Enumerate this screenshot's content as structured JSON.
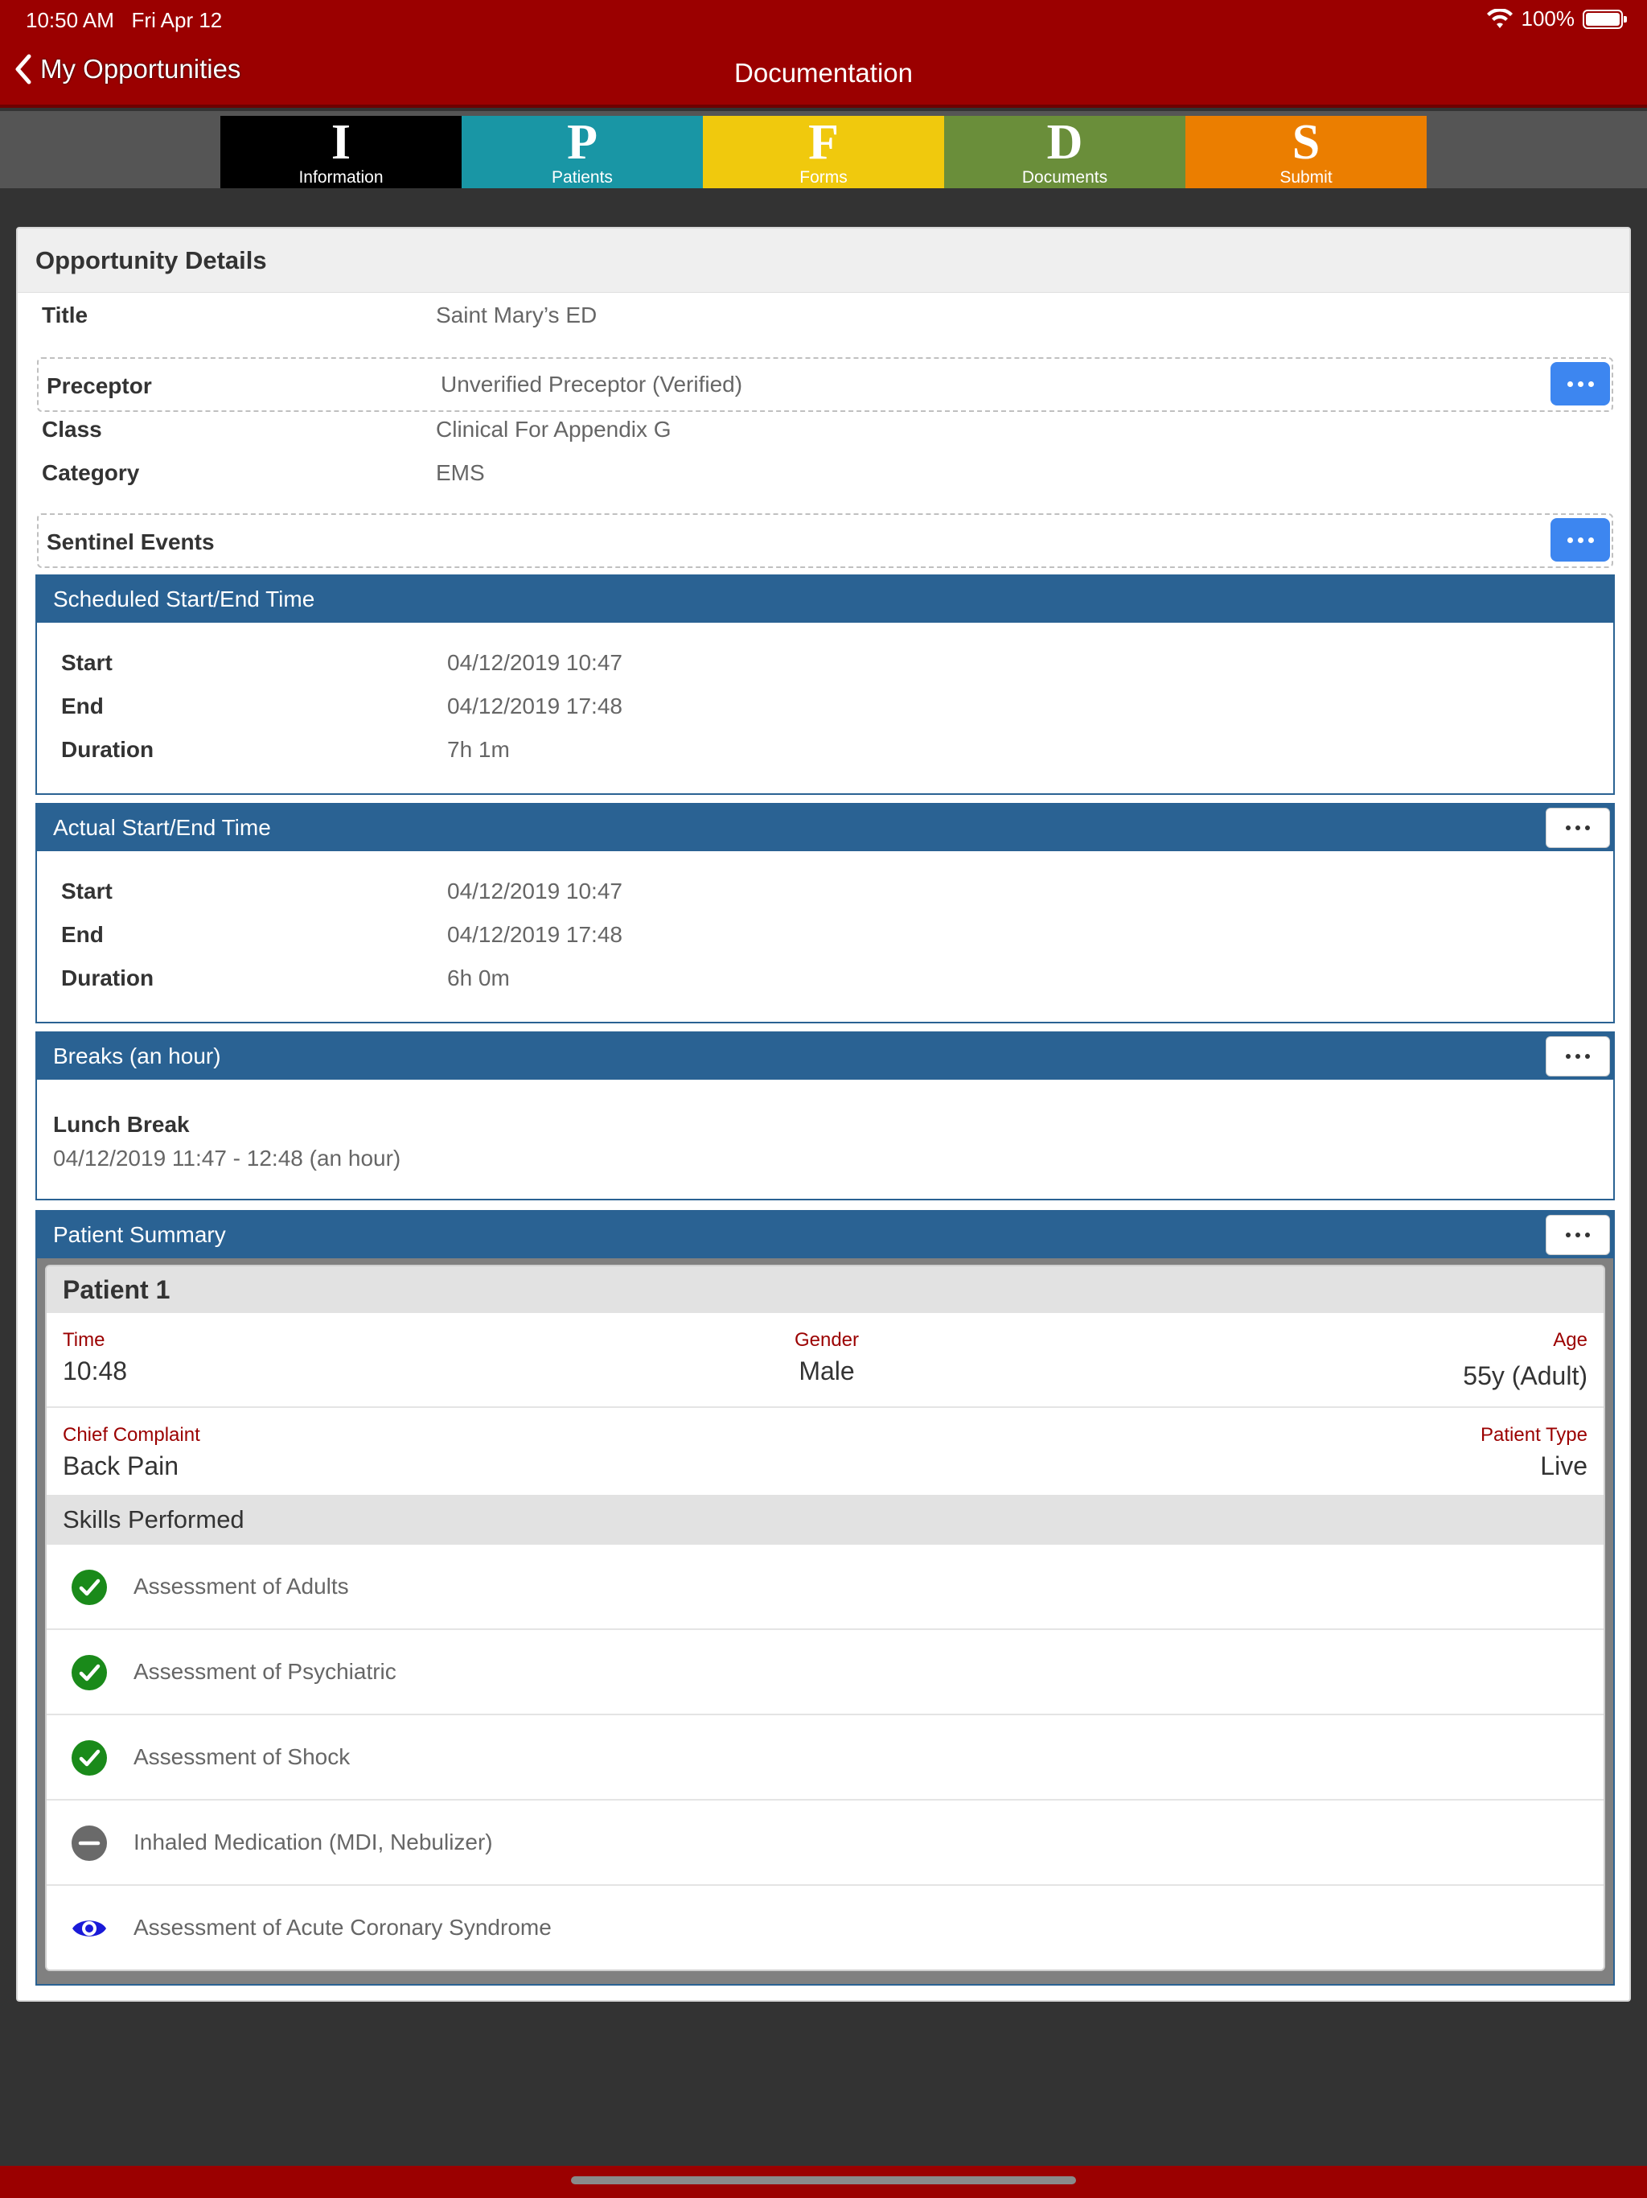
{
  "status_bar": {
    "time": "10:50 AM",
    "date": "Fri Apr 12",
    "battery": "100%"
  },
  "nav": {
    "back_label": "My Opportunities",
    "title": "Documentation"
  },
  "tabs": [
    {
      "letter": "I",
      "label": "Information",
      "color": "#000000"
    },
    {
      "letter": "P",
      "label": "Patients",
      "color": "#1996a5"
    },
    {
      "letter": "F",
      "label": "Forms",
      "color": "#f0c90d"
    },
    {
      "letter": "D",
      "label": "Documents",
      "color": "#6a8e3a"
    },
    {
      "letter": "S",
      "label": "Submit",
      "color": "#eb7e00"
    }
  ],
  "opportunity": {
    "header": "Opportunity Details",
    "title_label": "Title",
    "title_value": "Saint Mary’s ED",
    "preceptor_label": "Preceptor",
    "preceptor_value": "Unverified Preceptor (Verified)",
    "class_label": "Class",
    "class_value": "Clinical For Appendix G",
    "category_label": "Category",
    "category_value": "EMS",
    "sentinel_label": "Sentinel Events"
  },
  "scheduled": {
    "header": "Scheduled Start/End Time",
    "start_label": "Start",
    "start_value": "04/12/2019 10:47",
    "end_label": "End",
    "end_value": "04/12/2019 17:48",
    "duration_label": "Duration",
    "duration_value": "7h 1m"
  },
  "actual": {
    "header": "Actual Start/End Time",
    "start_label": "Start",
    "start_value": "04/12/2019 10:47",
    "end_label": "End",
    "end_value": "04/12/2019 17:48",
    "duration_label": "Duration",
    "duration_value": "6h 0m"
  },
  "breaks": {
    "header": "Breaks (an hour)",
    "item_title": "Lunch Break",
    "item_detail": "04/12/2019 11:47 - 12:48 (an hour)"
  },
  "patient_summary": {
    "header": "Patient Summary",
    "patient_title": "Patient 1",
    "time_label": "Time",
    "time_value": "10:48",
    "gender_label": "Gender",
    "gender_value": "Male",
    "age_label": "Age",
    "age_value": "55y (Adult)",
    "complaint_label": "Chief Complaint",
    "complaint_value": "Back Pain",
    "type_label": "Patient Type",
    "type_value": "Live",
    "skills_header": "Skills Performed",
    "skills": [
      {
        "label": "Assessment of Adults",
        "status_icon": "check-circle-icon"
      },
      {
        "label": "Assessment of Psychiatric",
        "status_icon": "check-circle-icon"
      },
      {
        "label": "Assessment of Shock",
        "status_icon": "check-circle-icon"
      },
      {
        "label": "Inhaled Medication (MDI, Nebulizer)",
        "status_icon": "minus-circle-icon"
      },
      {
        "label": "Assessment of Acute Coronary Syndrome",
        "status_icon": "eye-icon"
      }
    ]
  },
  "colors": {
    "brand_red": "#9b0000",
    "section_blue": "#2a6293",
    "button_blue": "#3d86f0",
    "check_green": "#1a8a1a"
  }
}
